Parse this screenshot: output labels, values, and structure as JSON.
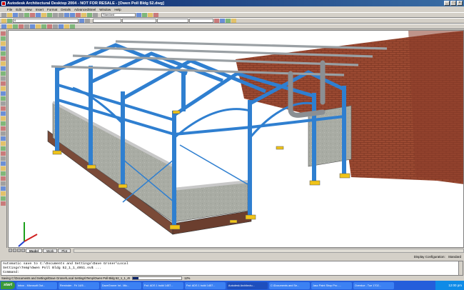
{
  "window": {
    "title": "Autodesk Architectural Desktop 2004 - NOT FOR RESALE - [Owen Poll Bldg 52.dwg]"
  },
  "menu": {
    "items": [
      "File",
      "Edit",
      "View",
      "Insert",
      "Format",
      "Details",
      "AdvancedSteel",
      "Window",
      "Help"
    ]
  },
  "toolbar": {
    "standard_combo": "Standard",
    "layer_combo": "0"
  },
  "tabs": {
    "model": "Model",
    "layout1": "Work",
    "layout2": "Plot"
  },
  "status": {
    "display_config_label": "Display Configuration:",
    "display_config_value": "Standard"
  },
  "command_line": {
    "line1": "Automatic save to C:\\Documents and Settings\\Dave Groner\\Local",
    "line2": "Settings\\Temp\\Owen Poll Bldg 52_1_1_4951.sv$ ...",
    "line3": "Command:"
  },
  "progress": {
    "label": "Saving C:\\Documents and Settings\\Dave Groner\\Local Settings\\Temp\\Owen Poll Bldg 52_1_1_4951.sv$",
    "percent": 12,
    "percent_text": "12%"
  },
  "taskbar": {
    "start": "start",
    "tasks": [
      "Inbox - Microsoft Out...",
      "Reminder - Fri 14/5...",
      "DaveGroner Int - Mic...",
      "Fwl: ADS 1 build 1457...",
      "Fwl: ADS 1 build 1457...",
      "Autodesk Architectu...",
      "C:\\Documents and Se...",
      "Jasc Paint Shop Pro -...",
      "Overdue - Tue 1702..."
    ],
    "clock": "12:00 pm"
  },
  "colors": {
    "steel": "#2f7fd0",
    "brick": "#9c4a32",
    "title_gradient_start": "#0a246a",
    "taskbar": "#245edb"
  }
}
